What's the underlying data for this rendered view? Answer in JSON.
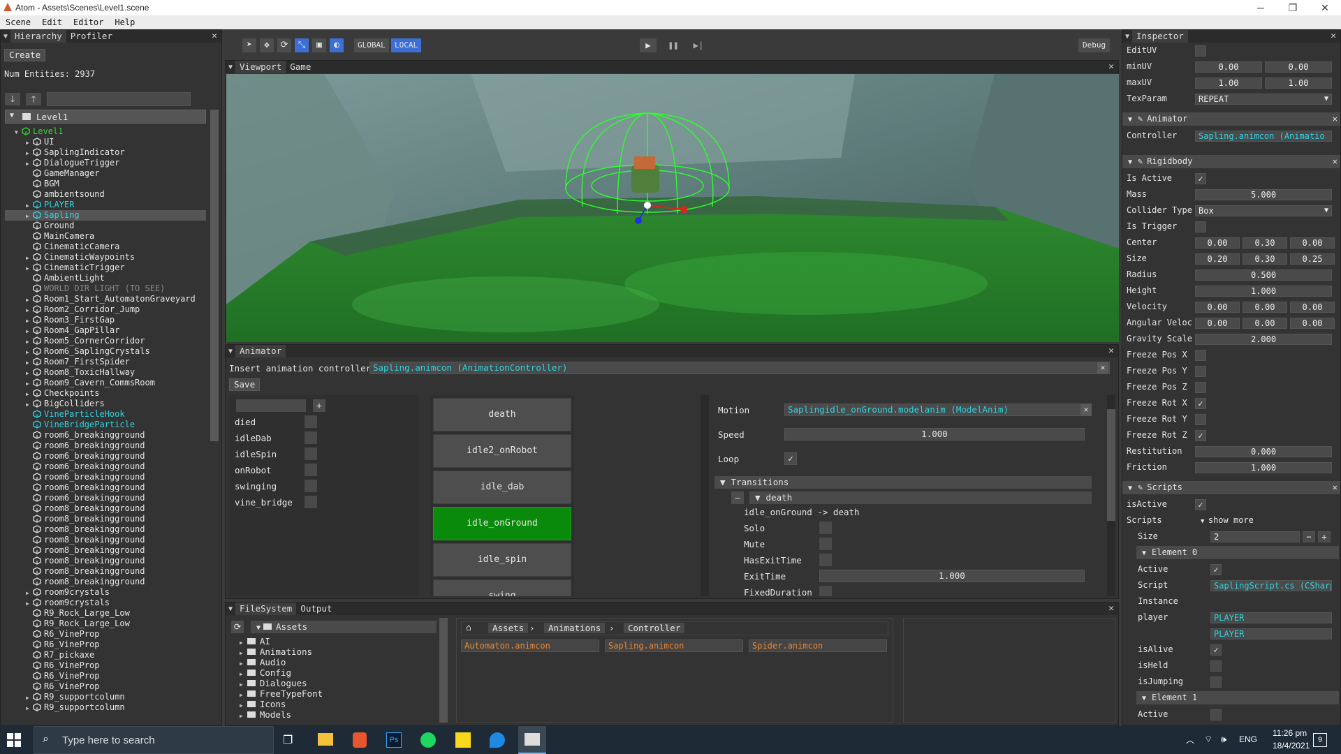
{
  "window": {
    "title": "Atom - Assets\\Scenes\\Level1.scene",
    "minimize": "─",
    "maximize": "❐",
    "close": "✕"
  },
  "menu": [
    "Scene",
    "Edit",
    "Editor",
    "Help"
  ],
  "hierarchy": {
    "tabs": [
      "Hierarchy",
      "Profiler"
    ],
    "create_label": "Create",
    "num_entities": "Num Entities: 2937",
    "root": "Level1",
    "items": [
      {
        "name": "Level1",
        "depth": 1,
        "color": "green",
        "arrow": true,
        "open": true
      },
      {
        "name": "UI",
        "depth": 2,
        "arrow": true
      },
      {
        "name": "SaplingIndicator",
        "depth": 2,
        "arrow": true
      },
      {
        "name": "DialogueTrigger",
        "depth": 2,
        "arrow": true
      },
      {
        "name": "GameManager",
        "depth": 2
      },
      {
        "name": "BGM",
        "depth": 2
      },
      {
        "name": "ambientsound",
        "depth": 2
      },
      {
        "name": "PLAYER",
        "depth": 2,
        "color": "cyan",
        "arrow": true
      },
      {
        "name": "Sapling",
        "depth": 2,
        "color": "cyan",
        "arrow": true,
        "selected": true
      },
      {
        "name": "Ground",
        "depth": 2
      },
      {
        "name": "MainCamera",
        "depth": 2
      },
      {
        "name": "CinematicCamera",
        "depth": 2
      },
      {
        "name": "CinematicWaypoints",
        "depth": 2,
        "arrow": true
      },
      {
        "name": "CinematicTrigger",
        "depth": 2,
        "arrow": true
      },
      {
        "name": "AmbientLight",
        "depth": 2
      },
      {
        "name": "WORLD DIR LIGHT (TO SEE)",
        "depth": 2,
        "color": "gray"
      },
      {
        "name": "Room1_Start_AutomatonGraveyard",
        "depth": 2,
        "arrow": true
      },
      {
        "name": "Room2_Corridor_Jump",
        "depth": 2,
        "arrow": true
      },
      {
        "name": "Room3_FirstGap",
        "depth": 2,
        "arrow": true
      },
      {
        "name": "Room4_GapPillar",
        "depth": 2,
        "arrow": true
      },
      {
        "name": "Room5_CornerCorridor",
        "depth": 2,
        "arrow": true
      },
      {
        "name": "Room6_SaplingCrystals",
        "depth": 2,
        "arrow": true
      },
      {
        "name": "Room7_FirstSpider",
        "depth": 2,
        "arrow": true
      },
      {
        "name": "Room8_ToxicHallway",
        "depth": 2,
        "arrow": true
      },
      {
        "name": "Room9_Cavern_CommsRoom",
        "depth": 2,
        "arrow": true
      },
      {
        "name": "Checkpoints",
        "depth": 2,
        "arrow": true
      },
      {
        "name": "BigColliders",
        "depth": 2,
        "arrow": true
      },
      {
        "name": "VineParticleHook",
        "depth": 2,
        "color": "cyan"
      },
      {
        "name": "VineBridgeParticle",
        "depth": 2,
        "color": "cyan"
      },
      {
        "name": "room6_breakingground",
        "depth": 2
      },
      {
        "name": "room6_breakingground",
        "depth": 2
      },
      {
        "name": "room6_breakingground",
        "depth": 2
      },
      {
        "name": "room6_breakingground",
        "depth": 2
      },
      {
        "name": "room6_breakingground",
        "depth": 2
      },
      {
        "name": "room6_breakingground",
        "depth": 2
      },
      {
        "name": "room6_breakingground",
        "depth": 2
      },
      {
        "name": "room8_breakingground",
        "depth": 2
      },
      {
        "name": "room8_breakingground",
        "depth": 2
      },
      {
        "name": "room8_breakingground",
        "depth": 2
      },
      {
        "name": "room8_breakingground",
        "depth": 2
      },
      {
        "name": "room8_breakingground",
        "depth": 2
      },
      {
        "name": "room8_breakingground",
        "depth": 2
      },
      {
        "name": "room8_breakingground",
        "depth": 2
      },
      {
        "name": "room8_breakingground",
        "depth": 2
      },
      {
        "name": "room9crystals",
        "depth": 2,
        "arrow": true
      },
      {
        "name": "room9crystals",
        "depth": 2,
        "arrow": true
      },
      {
        "name": "R9_Rock_Large_Low",
        "depth": 2
      },
      {
        "name": "R9_Rock_Large_Low",
        "depth": 2
      },
      {
        "name": "R6_VineProp",
        "depth": 2
      },
      {
        "name": "R6_VineProp",
        "depth": 2
      },
      {
        "name": "R7_pickaxe",
        "depth": 2
      },
      {
        "name": "R6_VineProp",
        "depth": 2
      },
      {
        "name": "R6_VineProp",
        "depth": 2
      },
      {
        "name": "R6_VineProp",
        "depth": 2
      },
      {
        "name": "R9_supportcolumn",
        "depth": 2,
        "arrow": true
      },
      {
        "name": "R9_supportcolumn",
        "depth": 2,
        "arrow": true
      }
    ]
  },
  "toolbar": {
    "global": "GLOBAL",
    "local": "LOCAL",
    "debug": "Debug"
  },
  "viewport": {
    "tabs": [
      "Viewport",
      "Game"
    ]
  },
  "animator": {
    "title": "Animator",
    "insert_label": "Insert animation controller",
    "controller_value": "Sapling.animcon (AnimationController)",
    "save_label": "Save",
    "params": [
      "died",
      "idleDab",
      "idleSpin",
      "onRobot",
      "swinging",
      "vine_bridge"
    ],
    "states": [
      "death",
      "idle2_onRobot",
      "idle_dab",
      "idle_onGround",
      "idle_spin",
      "swing"
    ],
    "active_state": "idle_onGround",
    "motion_label": "Motion",
    "motion_value": "Saplingidle_onGround.modelanim (ModelAnim)",
    "speed_label": "Speed",
    "speed_value": "1.000",
    "loop_label": "Loop",
    "transitions_label": "Transitions",
    "transition_name": "death",
    "transition_desc": "idle_onGround -> death",
    "solo": "Solo",
    "mute": "Mute",
    "hasexit": "HasExitTime",
    "exittime": "ExitTime",
    "exittime_value": "1.000",
    "fixed": "FixedDuration"
  },
  "filesystem": {
    "tabs": [
      "FileSystem",
      "Output"
    ],
    "root": "Assets",
    "folders": [
      "AI",
      "Animations",
      "Audio",
      "Config",
      "Dialogues",
      "FreeTypeFont",
      "Icons",
      "Models"
    ],
    "breadcrumb": [
      "Assets",
      "Animations",
      "Controller"
    ],
    "files": [
      "Automaton.animcon",
      "Sapling.animcon",
      "Spider.animcon"
    ]
  },
  "inspector": {
    "title": "Inspector",
    "top_rows": [
      {
        "label": "EditUV",
        "type": "check"
      },
      {
        "label": "minUV",
        "values": [
          "0.00",
          "0.00"
        ]
      },
      {
        "label": "maxUV",
        "values": [
          "1.00",
          "1.00"
        ]
      },
      {
        "label": "TexParam",
        "dropdown": "REPEAT"
      }
    ],
    "animator_hdr": "Animator",
    "controller_label": "Controller",
    "controller_value": "Sapling.animcon (Animatio",
    "rigidbody_hdr": "Rigidbody",
    "rb_rows": [
      {
        "label": "Is Active",
        "check": "✓"
      },
      {
        "label": "Mass",
        "value": "5.000"
      },
      {
        "label": "Collider Type",
        "dropdown": "Box"
      },
      {
        "label": "Is Trigger",
        "check": ""
      },
      {
        "label": "Center",
        "values": [
          "0.00",
          "0.30",
          "0.00"
        ]
      },
      {
        "label": "Size",
        "values": [
          "0.20",
          "0.30",
          "0.25"
        ]
      },
      {
        "label": "Radius",
        "value": "0.500"
      },
      {
        "label": "Height",
        "value": "1.000"
      },
      {
        "label": "Velocity",
        "values": [
          "0.00",
          "0.00",
          "0.00"
        ]
      },
      {
        "label": "Angular Veloc",
        "values": [
          "0.00",
          "0.00",
          "0.00"
        ]
      },
      {
        "label": "Gravity Scale",
        "value": "2.000"
      },
      {
        "label": "Freeze Pos X",
        "check": ""
      },
      {
        "label": "Freeze Pos Y",
        "check": ""
      },
      {
        "label": "Freeze Pos Z",
        "check": ""
      },
      {
        "label": "Freeze Rot X",
        "check": "✓"
      },
      {
        "label": "Freeze Rot Y",
        "check": ""
      },
      {
        "label": "Freeze Rot Z",
        "check": "✓"
      },
      {
        "label": "Restitution",
        "value": "0.000"
      },
      {
        "label": "Friction",
        "value": "1.000"
      }
    ],
    "scripts_hdr": "Scripts",
    "isactive_label": "isActive",
    "scripts_label": "Scripts",
    "show_more": "show more",
    "size_label": "Size",
    "size_value": "2",
    "element0": "Element 0",
    "active_label": "Active",
    "script_label": "Script",
    "script_value": "SaplingScript.cs (CSharp",
    "instance_label": "Instance",
    "player_label": "player",
    "player_value1": "PLAYER",
    "player_value2": "PLAYER",
    "isalive_label": "isAlive",
    "isheld_label": "isHeld",
    "isjumping_label": "isJumping",
    "element1": "Element 1",
    "active2_label": "Active"
  },
  "taskbar": {
    "search_placeholder": "Type here to search",
    "lang": "ENG",
    "time": "11:26 pm",
    "date": "18/4/2021",
    "notif_count": "9"
  }
}
